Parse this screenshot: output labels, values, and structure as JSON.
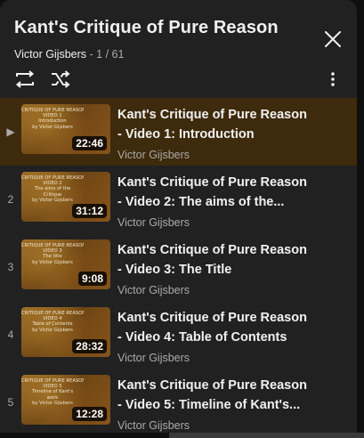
{
  "playlist": {
    "title": "Kant's Critique of Pure Reason",
    "owner": "Victor Gijsbers",
    "position": "1 / 61",
    "separator": " - "
  },
  "colors": {
    "panel_bg": "#212121",
    "active_row_bg": "#3e2a0c",
    "primary_text": "#f1f1f1",
    "secondary_text": "#aaaaaa"
  },
  "icons": {
    "close": "close-icon",
    "loop": "loop-icon",
    "shuffle": "shuffle-icon",
    "more": "more-vert-icon",
    "now_playing": "play-indicator-icon"
  },
  "videos": [
    {
      "index": "▶",
      "title": "Kant's Critique of Pure Reason - Video 1: Introduction",
      "channel": "Victor Gijsbers",
      "duration": "22:46",
      "thumb_lines": [
        "CRITIQUE OF PURE REASON",
        "VIDEO 1",
        "Introduction",
        "",
        "by Victor Gijsbers"
      ]
    },
    {
      "index": "2",
      "title": "Kant's Critique of Pure Reason - Video 2: The aims of the...",
      "channel": "Victor Gijsbers",
      "duration": "31:12",
      "thumb_lines": [
        "CRITIQUE OF PURE REASON",
        "VIDEO 2",
        "The aims of the",
        "Critique",
        "by Victor Gijsbers"
      ]
    },
    {
      "index": "3",
      "title": "Kant's Critique of Pure Reason - Video 3: The Title",
      "channel": "Victor Gijsbers",
      "duration": "9:08",
      "thumb_lines": [
        "CRITIQUE OF PURE REASON",
        "VIDEO 3",
        "The title",
        "",
        "by Victor Gijsbers"
      ]
    },
    {
      "index": "4",
      "title": "Kant's Critique of Pure Reason - Video 4: Table of Contents",
      "channel": "Victor Gijsbers",
      "duration": "28:32",
      "thumb_lines": [
        "CRITIQUE OF PURE REASON",
        "VIDEO 4",
        "Table of Contents",
        "",
        "by Victor Gijsbers"
      ]
    },
    {
      "index": "5",
      "title": "Kant's Critique of Pure Reason - Video 5: Timeline of Kant's...",
      "channel": "Victor Gijsbers",
      "duration": "12:28",
      "thumb_lines": [
        "CRITIQUE OF PURE REASON",
        "VIDEO 5",
        "Timeline of Kant's",
        "work",
        "by Victor Gijsbers"
      ]
    }
  ]
}
